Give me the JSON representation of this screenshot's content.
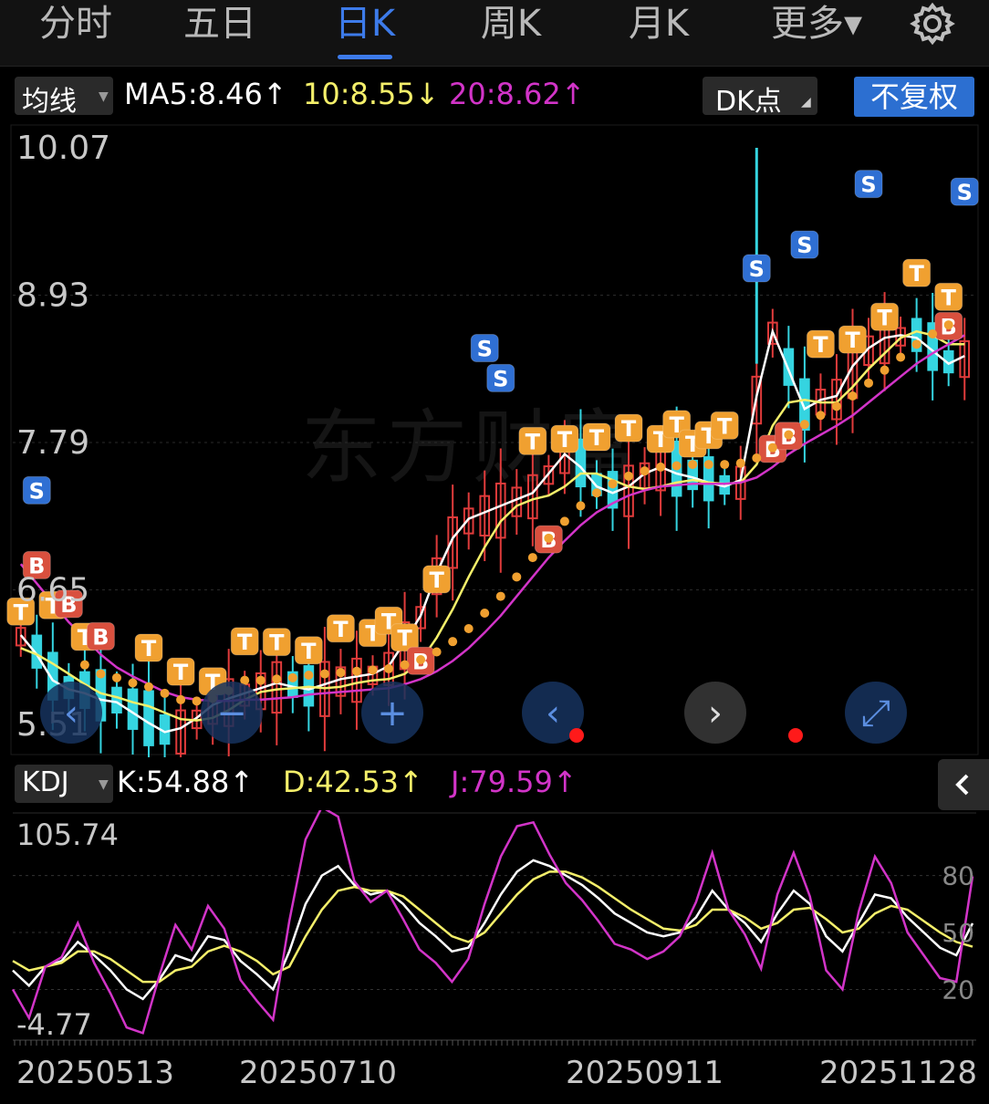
{
  "tabs": [
    {
      "label": "分时",
      "active": false
    },
    {
      "label": "五日",
      "active": false
    },
    {
      "label": "日K",
      "active": true
    },
    {
      "label": "周K",
      "active": false
    },
    {
      "label": "月K",
      "active": false
    },
    {
      "label": "更多▾",
      "active": false
    }
  ],
  "legend": {
    "ma_selector": "均线",
    "ma5": "MA5:8.46↑",
    "ma10": "10:8.55↓",
    "ma20": "20:8.62↑",
    "dk_button": "DK点",
    "adjust_button": "不复权"
  },
  "kdj_legend": {
    "selector": "KDJ",
    "k": "K:54.88↑",
    "d": "D:42.53↑",
    "j": "J:79.59↑"
  },
  "colors": {
    "accent": "#3d7bea",
    "up": "#e03b3b",
    "down": "#35d4e0",
    "ma5": "#ffffff",
    "ma10": "#f4ef6a",
    "ma20": "#d234c8",
    "marker": "#f0a030"
  },
  "watermark": "东方财富",
  "chart_data": [
    {
      "type": "candlestick",
      "price_ticks": [
        "10.07",
        "8.93",
        "7.79",
        "6.65",
        "5.51"
      ],
      "ylim": [
        5.51,
        10.07
      ],
      "series": [
        {
          "name": "MA5",
          "value_label": "8.46",
          "values": [
            6.3,
            6.15,
            5.95,
            5.88,
            5.85,
            5.8,
            5.78,
            5.7,
            5.62,
            5.55,
            5.58,
            5.66,
            5.76,
            5.81,
            5.85,
            5.89,
            5.93,
            5.9,
            5.88,
            5.92,
            5.96,
            5.98,
            6.0,
            6.06,
            6.25,
            6.45,
            6.78,
            7.05,
            7.2,
            7.25,
            7.3,
            7.35,
            7.4,
            7.55,
            7.7,
            7.6,
            7.45,
            7.4,
            7.45,
            7.55,
            7.6,
            7.55,
            7.52,
            7.48,
            7.45,
            7.5,
            8.15,
            8.65,
            8.35,
            8.05,
            8.12,
            8.15,
            8.38,
            8.52,
            8.6,
            8.62,
            8.6,
            8.5,
            8.4,
            8.46
          ]
        },
        {
          "name": "10",
          "value_label": "8.55",
          "values": [
            6.2,
            6.15,
            6.08,
            6.0,
            5.92,
            5.85,
            5.82,
            5.78,
            5.75,
            5.7,
            5.65,
            5.64,
            5.66,
            5.72,
            5.8,
            5.86,
            5.88,
            5.89,
            5.9,
            5.89,
            5.9,
            5.93,
            5.95,
            5.96,
            6.0,
            6.1,
            6.28,
            6.5,
            6.75,
            6.98,
            7.18,
            7.3,
            7.35,
            7.38,
            7.45,
            7.55,
            7.55,
            7.5,
            7.45,
            7.43,
            7.45,
            7.48,
            7.5,
            7.48,
            7.47,
            7.48,
            7.62,
            7.92,
            8.1,
            8.12,
            8.1,
            8.1,
            8.22,
            8.36,
            8.48,
            8.6,
            8.65,
            8.62,
            8.55,
            8.55
          ]
        },
        {
          "name": "20",
          "value_label": "8.62",
          "values": [
            6.85,
            6.7,
            6.55,
            6.4,
            6.28,
            6.15,
            6.05,
            5.98,
            5.92,
            5.86,
            5.82,
            5.8,
            5.79,
            5.79,
            5.8,
            5.8,
            5.81,
            5.82,
            5.84,
            5.85,
            5.86,
            5.87,
            5.88,
            5.89,
            5.92,
            5.96,
            6.02,
            6.1,
            6.2,
            6.32,
            6.45,
            6.6,
            6.75,
            6.9,
            7.03,
            7.15,
            7.25,
            7.32,
            7.38,
            7.42,
            7.45,
            7.46,
            7.47,
            7.47,
            7.47,
            7.48,
            7.52,
            7.6,
            7.7,
            7.78,
            7.85,
            7.92,
            8.0,
            8.1,
            8.2,
            8.3,
            8.4,
            8.48,
            8.55,
            8.62
          ]
        }
      ]
    },
    {
      "type": "line",
      "title": "KDJ",
      "ylim": [
        -4.77,
        105.74
      ],
      "y_ticks_left": [
        "105.74",
        "-4.77"
      ],
      "y_ticks_right": [
        "80",
        "50",
        "20"
      ],
      "x_tick_labels": [
        "20250513",
        "20250710",
        "20250911",
        "20251128"
      ],
      "series": [
        {
          "name": "K",
          "value_label": "54.88",
          "values": [
            30,
            22,
            32,
            35,
            45,
            38,
            30,
            20,
            15,
            25,
            38,
            35,
            48,
            46,
            35,
            28,
            20,
            40,
            65,
            80,
            85,
            75,
            70,
            72,
            65,
            55,
            48,
            40,
            42,
            55,
            70,
            82,
            88,
            85,
            80,
            75,
            68,
            60,
            55,
            50,
            48,
            50,
            58,
            72,
            62,
            55,
            45,
            60,
            72,
            65,
            48,
            40,
            55,
            70,
            68,
            58,
            50,
            42,
            38,
            54.88
          ]
        },
        {
          "name": "D",
          "value_label": "42.53",
          "values": [
            35,
            30,
            32,
            34,
            40,
            40,
            36,
            30,
            24,
            24,
            30,
            32,
            40,
            43,
            40,
            35,
            28,
            32,
            48,
            62,
            72,
            74,
            72,
            72,
            69,
            62,
            55,
            48,
            45,
            50,
            60,
            70,
            78,
            82,
            82,
            79,
            74,
            68,
            62,
            57,
            52,
            51,
            54,
            62,
            62,
            58,
            52,
            55,
            62,
            63,
            57,
            50,
            52,
            60,
            64,
            62,
            56,
            50,
            45,
            42.53
          ]
        },
        {
          "name": "J",
          "value_label": "79.59",
          "values": [
            20,
            5,
            32,
            37,
            55,
            34,
            18,
            0,
            -3,
            27,
            54,
            41,
            64,
            52,
            25,
            14,
            4,
            56,
            99,
            116,
            111,
            77,
            66,
            72,
            57,
            41,
            34,
            24,
            36,
            65,
            90,
            106,
            108,
            91,
            76,
            67,
            56,
            44,
            41,
            36,
            40,
            48,
            66,
            92,
            62,
            49,
            31,
            70,
            92,
            69,
            30,
            20,
            61,
            90,
            76,
            50,
            38,
            26,
            24,
            79.59
          ]
        }
      ]
    }
  ]
}
